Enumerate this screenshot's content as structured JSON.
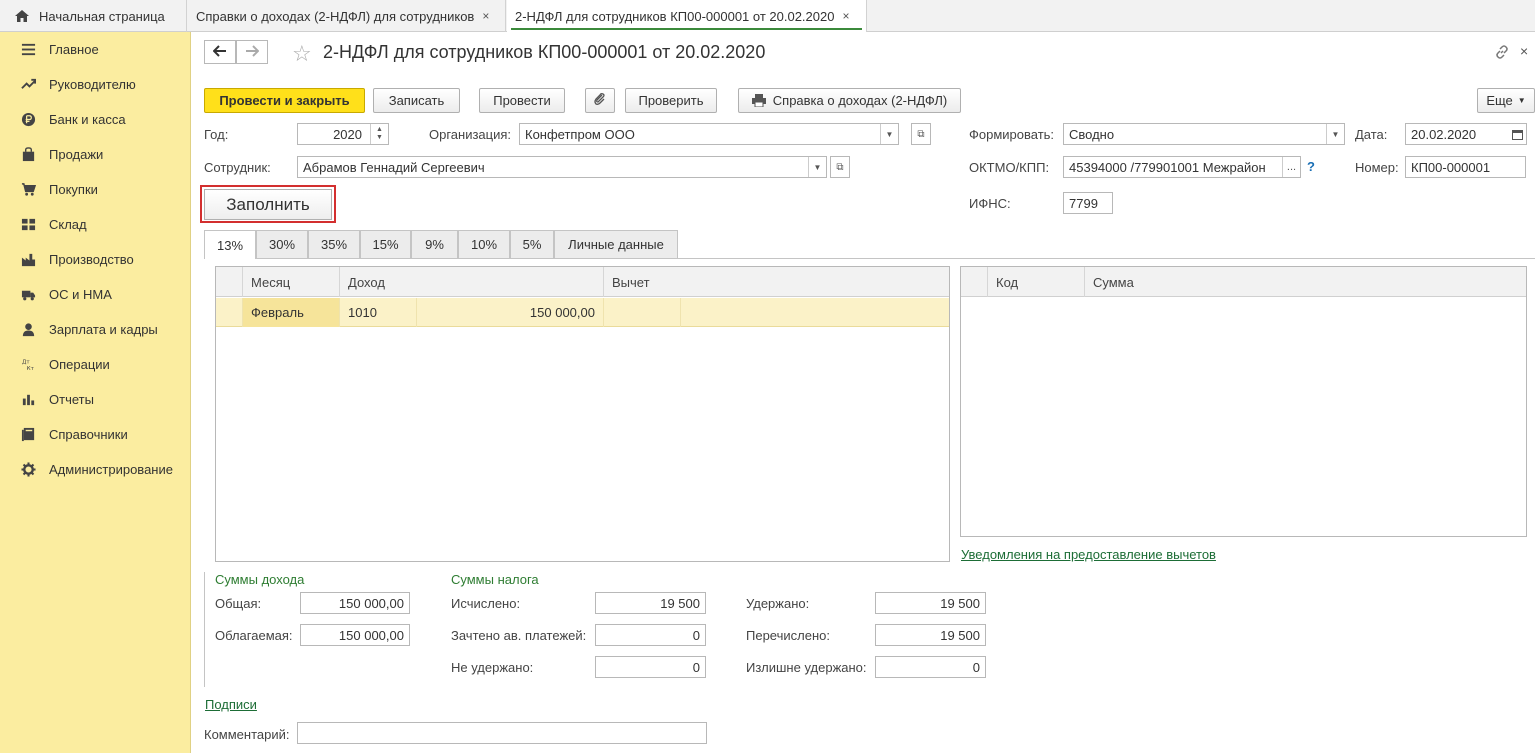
{
  "tabs": {
    "home": "Начальная страница",
    "tab1": "Справки о доходах (2-НДФЛ) для сотрудников",
    "tab2": "2-НДФЛ для сотрудников КП00-000001 от 20.02.2020",
    "close": "×"
  },
  "sidebar": {
    "items": [
      {
        "label": "Главное",
        "icon": "menu-icon"
      },
      {
        "label": "Руководителю",
        "icon": "trend-icon"
      },
      {
        "label": "Банк и касса",
        "icon": "ruble-icon"
      },
      {
        "label": "Продажи",
        "icon": "bag-icon"
      },
      {
        "label": "Покупки",
        "icon": "cart-icon"
      },
      {
        "label": "Склад",
        "icon": "warehouse-icon"
      },
      {
        "label": "Производство",
        "icon": "factory-icon"
      },
      {
        "label": "ОС и НМА",
        "icon": "truck-icon"
      },
      {
        "label": "Зарплата и кадры",
        "icon": "person-icon"
      },
      {
        "label": "Операции",
        "icon": "dt-kt-icon"
      },
      {
        "label": "Отчеты",
        "icon": "chart-icon"
      },
      {
        "label": "Справочники",
        "icon": "book-icon"
      },
      {
        "label": "Администрирование",
        "icon": "gear-icon"
      }
    ]
  },
  "document": {
    "title": "2-НДФЛ для сотрудников КП00-000001 от 20.02.2020"
  },
  "toolbar": {
    "post_close": "Провести и закрыть",
    "save": "Записать",
    "post": "Провести",
    "check": "Проверить",
    "print_report": "Справка о доходах (2-НДФЛ)",
    "more": "Еще"
  },
  "form": {
    "year_label": "Год:",
    "year": "2020",
    "org_label": "Организация:",
    "org": "Конфетпром ООО",
    "form_label": "Формировать:",
    "form_value": "Сводно",
    "date_label": "Дата:",
    "date": "20.02.2020",
    "employee_label": "Сотрудник:",
    "employee": "Абрамов Геннадий Сергеевич",
    "oktmo_label": "ОКТМО/КПП:",
    "oktmo": "45394000   /779901001 Межрайон",
    "help": "?",
    "number_label": "Номер:",
    "number": "КП00-000001",
    "ifns_label": "ИФНС:",
    "ifns": "7799",
    "fill": "Заполнить",
    "ellipsis": "..."
  },
  "rate_tabs": [
    "13%",
    "30%",
    "35%",
    "15%",
    "9%",
    "10%",
    "5%",
    "Личные данные"
  ],
  "income_table": {
    "columns": {
      "month": "Месяц",
      "income": "Доход",
      "deduction": "Вычет"
    },
    "rows": [
      {
        "month": "Февраль",
        "code": "1010",
        "amount": "150 000,00",
        "deduction": ""
      }
    ]
  },
  "deduction_table": {
    "columns": {
      "code": "Код",
      "sum": "Сумма"
    }
  },
  "notice_link": "Уведомления на предоставление вычетов",
  "income_sums": {
    "title": "Суммы дохода",
    "total_label": "Общая:",
    "total": "150 000,00",
    "taxable_label": "Облагаемая:",
    "taxable": "150 000,00"
  },
  "tax_sums": {
    "title": "Суммы налога",
    "calculated_label": "Исчислено:",
    "calculated": "19 500",
    "offset_label": "Зачтено ав. платежей:",
    "offset": "0",
    "not_withheld_label": "Не удержано:",
    "not_withheld": "0",
    "withheld_label": "Удержано:",
    "withheld": "19 500",
    "transferred_label": "Перечислено:",
    "transferred": "19 500",
    "overwithheld_label": "Излишне удержано:",
    "overwithheld": "0"
  },
  "signatures_link": "Подписи",
  "comment_label": "Комментарий:",
  "comment": ""
}
